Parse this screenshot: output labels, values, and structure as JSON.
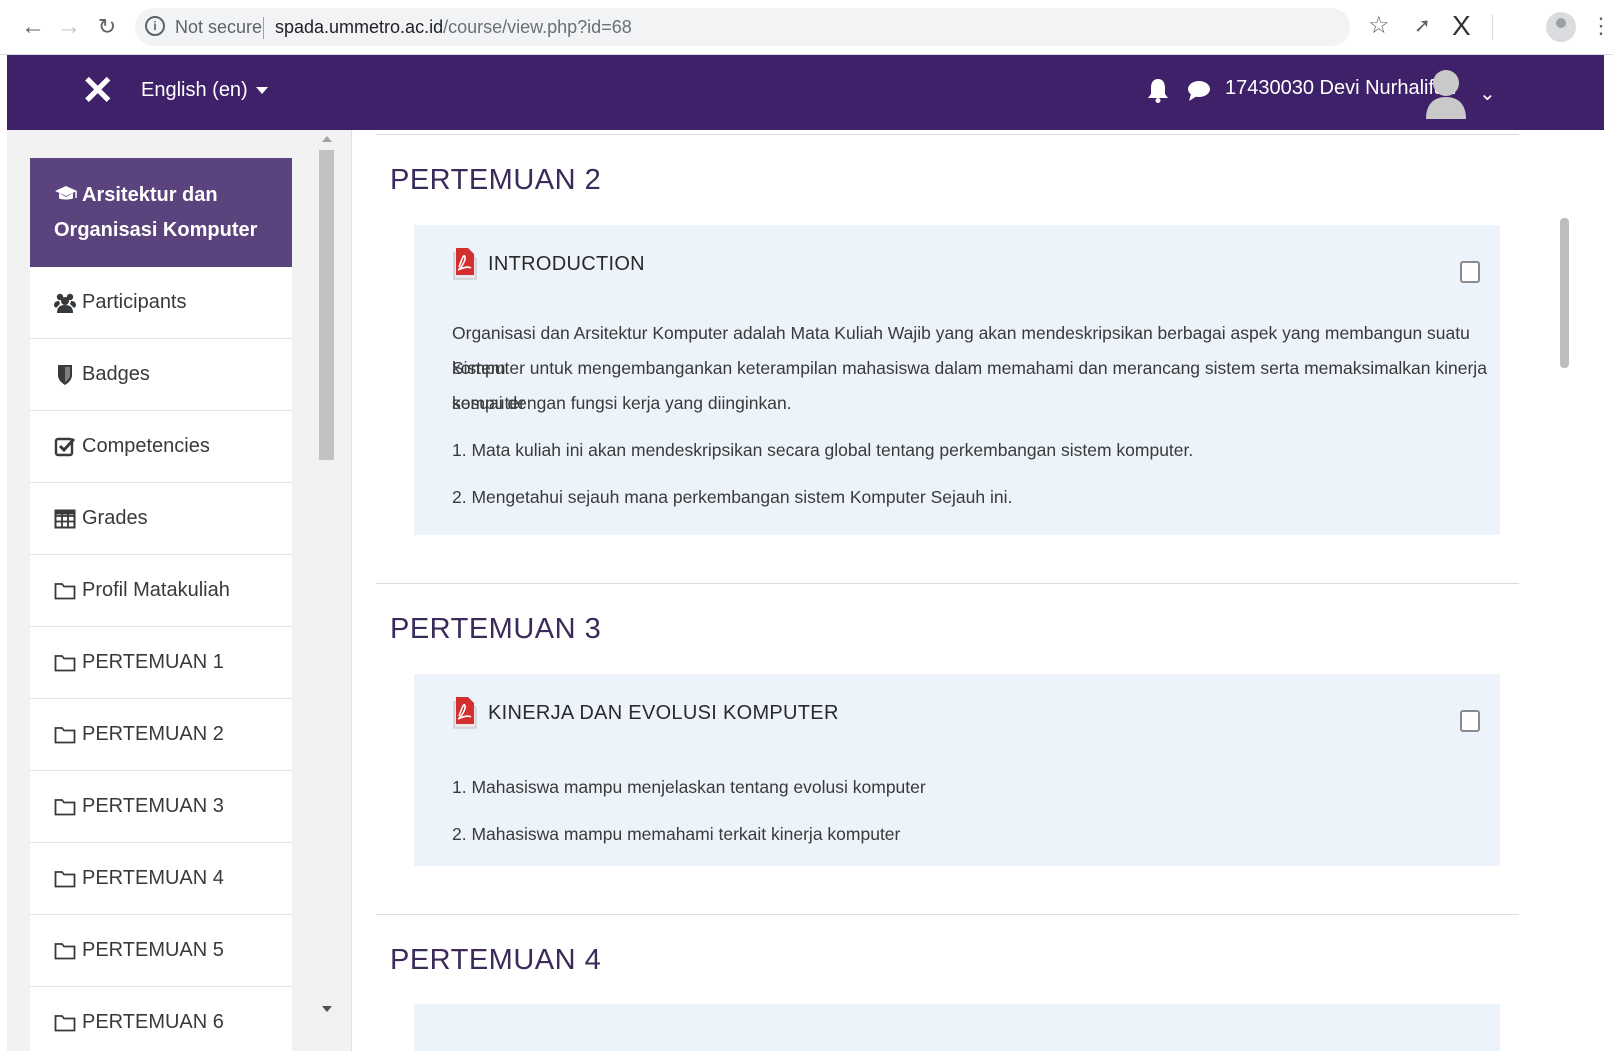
{
  "browser": {
    "not_secure": "Not secure",
    "url_host": "spada.ummetro.ac.id",
    "url_path": "/course/view.php?id=68"
  },
  "navbar": {
    "language": "English (en)",
    "username": "17430030 Devi Nurhalifah",
    "brand_color": "#3f216a"
  },
  "sidebar": {
    "course_title": "Arsitektur dan Organisasi Komputer",
    "items": [
      {
        "label": "Participants",
        "icon": "users-icon"
      },
      {
        "label": "Badges",
        "icon": "shield-icon"
      },
      {
        "label": "Competencies",
        "icon": "checkbox-icon"
      },
      {
        "label": "Grades",
        "icon": "table-icon"
      },
      {
        "label": "Profil Matakuliah",
        "icon": "folder-icon"
      },
      {
        "label": "PERTEMUAN 1",
        "icon": "folder-icon"
      },
      {
        "label": "PERTEMUAN 2",
        "icon": "folder-icon"
      },
      {
        "label": "PERTEMUAN 3",
        "icon": "folder-icon"
      },
      {
        "label": "PERTEMUAN 4",
        "icon": "folder-icon"
      },
      {
        "label": "PERTEMUAN 5",
        "icon": "folder-icon"
      },
      {
        "label": "PERTEMUAN 6",
        "icon": "folder-icon"
      }
    ]
  },
  "sections": [
    {
      "title": "PERTEMUAN 2",
      "activity_title": "INTRODUCTION",
      "lines": [
        "Organisasi dan Arsitektur Komputer adalah Mata Kuliah Wajib yang akan mendeskripsikan berbagai aspek yang membangun suatu Sistem",
        "komputer untuk mengembangankan keterampilan mahasiswa dalam memahami dan merancang sistem serta memaksimalkan kinerja komputer",
        "sesuai dengan fungsi kerja yang diinginkan.",
        "1. Mata kuliah ini akan mendeskripsikan secara global tentang perkembangan sistem komputer.",
        "2. Mengetahui sejauh mana perkembangan sistem Komputer Sejauh ini."
      ]
    },
    {
      "title": "PERTEMUAN 3",
      "activity_title": "KINERJA DAN EVOLUSI KOMPUTER",
      "lines": [
        "1. Mahasiswa mampu menjelaskan tentang evolusi komputer",
        "2. Mahasiswa mampu  memahami terkait kinerja komputer"
      ]
    },
    {
      "title": "PERTEMUAN 4"
    }
  ]
}
